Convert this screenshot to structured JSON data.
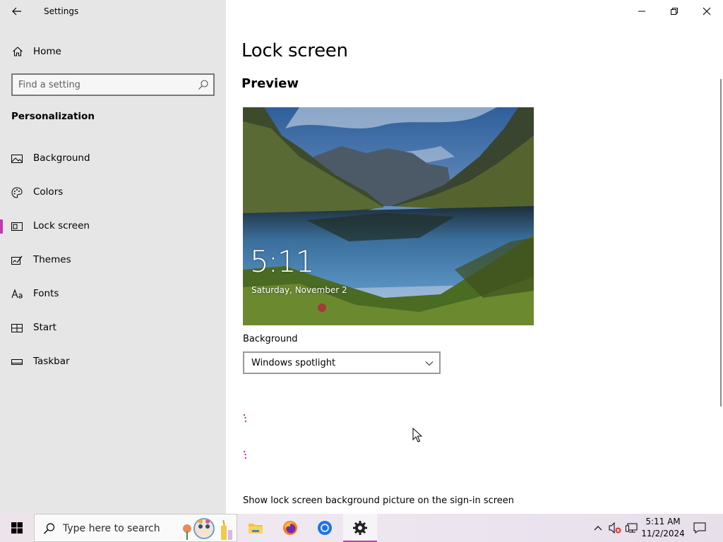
{
  "window": {
    "title": "Settings"
  },
  "sidebar": {
    "home_label": "Home",
    "search_placeholder": "Find a setting",
    "section_header": "Personalization",
    "items": [
      {
        "label": "Background",
        "icon": "picture-icon"
      },
      {
        "label": "Colors",
        "icon": "palette-icon"
      },
      {
        "label": "Lock screen",
        "icon": "lock-screen-icon",
        "selected": true
      },
      {
        "label": "Themes",
        "icon": "themes-icon"
      },
      {
        "label": "Fonts",
        "icon": "fonts-icon"
      },
      {
        "label": "Start",
        "icon": "start-icon"
      },
      {
        "label": "Taskbar",
        "icon": "taskbar-icon"
      }
    ],
    "accent_color": "#c239b3"
  },
  "main": {
    "page_title": "Lock screen",
    "preview_title": "Preview",
    "preview": {
      "time": "5:11",
      "date": "Saturday, November 2"
    },
    "background_label": "Background",
    "background_value": "Windows spotlight",
    "show_signin_label": "Show lock screen background picture on the sign-in screen"
  },
  "taskbar": {
    "search_text": "Type here to search",
    "apps": [
      "file-explorer-icon",
      "firefox-icon",
      "chrome-icon",
      "settings-icon"
    ],
    "clock_time": "5:11 AM",
    "clock_date": "11/2/2024"
  }
}
